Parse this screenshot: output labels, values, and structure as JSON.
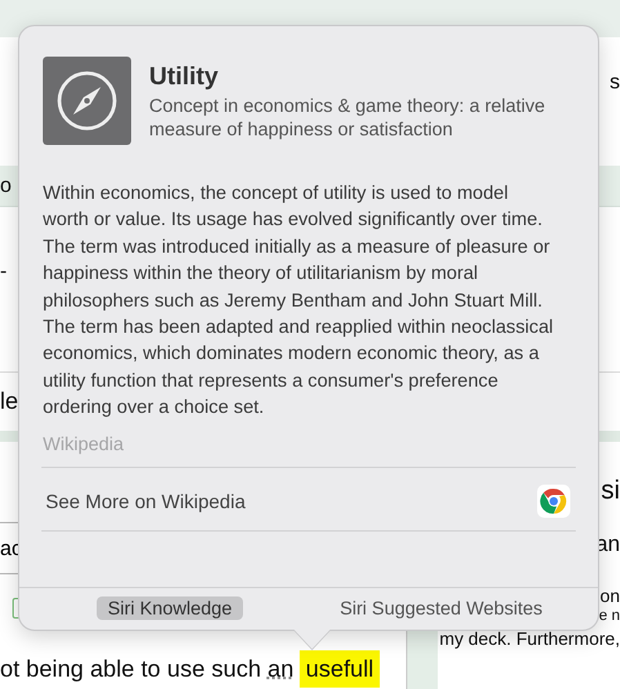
{
  "background_page": {
    "top_right_fragment": "s",
    "left_fragments": [
      "o",
      "-",
      "le"
    ],
    "field_fragment": "ac",
    "checkbox": {
      "checked": false
    },
    "side_panel_fragments": [
      "si",
      "an",
      "on",
      "e n",
      "my deck. Furthermore,"
    ],
    "sentence": {
      "before": "ot being able to use such ",
      "underlined": "an",
      "highlighted": "usefull"
    }
  },
  "popover": {
    "title": "Utility",
    "subtitle": "Concept in economics & game theory: a relative measure of happiness or satisfaction",
    "summary": "Within economics, the concept of utility is used to model worth or value. Its usage has evolved significantly over time. The term was introduced initially as a measure of pleasure or happiness within the theory of utilitarianism by moral philosophers such as Jeremy Bentham and John Stuart Mill. The term has been adapted and reapplied within neoclassical economics, which dominates modern economic theory, as a utility function that represents a consumer's preference ordering over a choice set.",
    "source": "Wikipedia",
    "link": "See More on Wikipedia",
    "tabs": [
      {
        "label": "Siri Knowledge",
        "selected": true
      },
      {
        "label": "Siri Suggested Websites",
        "selected": false
      }
    ]
  }
}
